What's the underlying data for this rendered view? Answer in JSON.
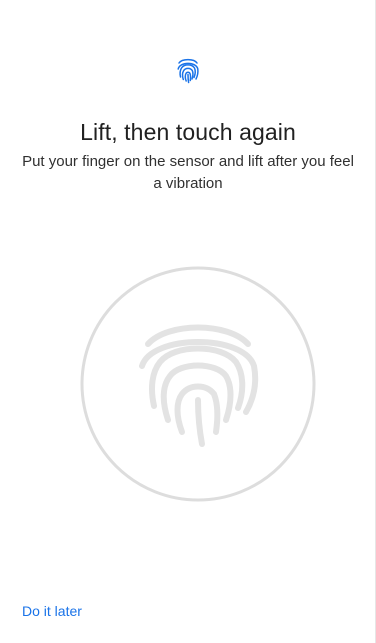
{
  "header": {
    "icon": "fingerprint-icon",
    "icon_color": "#1a73e8"
  },
  "main": {
    "title": "Lift, then touch again",
    "message": "Put your finger on the sensor and lift after you feel a vibration"
  },
  "sensor": {
    "icon": "fingerprint-icon",
    "ring_color": "#dddddd",
    "print_color": "#e3e3e3"
  },
  "footer": {
    "do_later_label": "Do it later",
    "link_color": "#1a73e8"
  }
}
